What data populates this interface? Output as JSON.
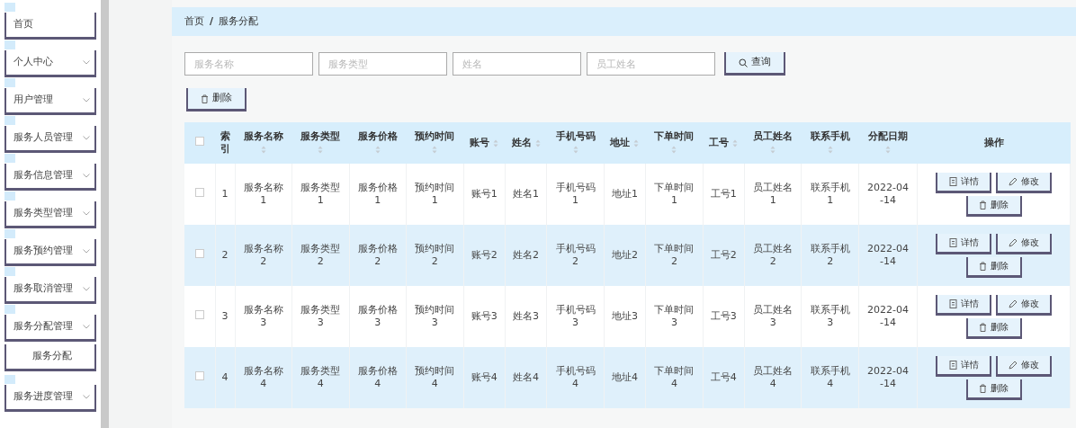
{
  "sidebar": {
    "items": [
      {
        "label": "首页",
        "kind": "link"
      },
      {
        "label": "个人中心",
        "kind": "menu"
      },
      {
        "label": "用户管理",
        "kind": "menu"
      },
      {
        "label": "服务人员管理",
        "kind": "menu"
      },
      {
        "label": "服务信息管理",
        "kind": "menu"
      },
      {
        "label": "服务类型管理",
        "kind": "menu"
      },
      {
        "label": "服务预约管理",
        "kind": "menu"
      },
      {
        "label": "服务取消管理",
        "kind": "menu"
      },
      {
        "label": "服务分配管理",
        "kind": "menu"
      },
      {
        "label": "服务分配",
        "kind": "sub"
      },
      {
        "label": "服务进度管理",
        "kind": "menu"
      }
    ]
  },
  "breadcrumb": {
    "items": [
      "首页",
      "服务分配"
    ],
    "separator": "/"
  },
  "search": {
    "fields": [
      {
        "placeholder": "服务名称"
      },
      {
        "placeholder": "服务类型"
      },
      {
        "placeholder": "姓名"
      },
      {
        "placeholder": "员工姓名"
      }
    ],
    "button": "查询"
  },
  "toolbar": {
    "delete_button": "删除"
  },
  "table": {
    "all_selected": false,
    "columns": [
      {
        "label": "索引",
        "sortable": false
      },
      {
        "label": "服务名称",
        "sortable": true
      },
      {
        "label": "服务类型",
        "sortable": true
      },
      {
        "label": "服务价格",
        "sortable": true
      },
      {
        "label": "预约时间",
        "sortable": true
      },
      {
        "label": "账号",
        "sortable": true
      },
      {
        "label": "姓名",
        "sortable": true
      },
      {
        "label": "手机号码",
        "sortable": true
      },
      {
        "label": "地址",
        "sortable": true
      },
      {
        "label": "下单时间",
        "sortable": true
      },
      {
        "label": "工号",
        "sortable": true
      },
      {
        "label": "员工姓名",
        "sortable": true
      },
      {
        "label": "联系手机",
        "sortable": true
      },
      {
        "label": "分配日期",
        "sortable": true
      },
      {
        "label": "操作",
        "sortable": false
      }
    ],
    "rows": [
      {
        "selected": false,
        "cells": [
          "1",
          "服务名称1",
          "服务类型1",
          "服务价格1",
          "预约时间1",
          "账号1",
          "姓名1",
          "手机号码1",
          "地址1",
          "下单时间1",
          "工号1",
          "员工姓名1",
          "联系手机1",
          "2022-04-14"
        ],
        "actions": [
          {
            "kind": "detail",
            "label": "详情"
          },
          {
            "kind": "edit",
            "label": "修改"
          },
          {
            "kind": "delete",
            "label": "删除"
          }
        ]
      },
      {
        "selected": false,
        "cells": [
          "2",
          "服务名称2",
          "服务类型2",
          "服务价格2",
          "预约时间2",
          "账号2",
          "姓名2",
          "手机号码2",
          "地址2",
          "下单时间2",
          "工号2",
          "员工姓名2",
          "联系手机2",
          "2022-04-14"
        ],
        "actions": [
          {
            "kind": "detail",
            "label": "详情"
          },
          {
            "kind": "edit",
            "label": "修改"
          },
          {
            "kind": "delete",
            "label": "删除"
          }
        ]
      },
      {
        "selected": false,
        "cells": [
          "3",
          "服务名称3",
          "服务类型3",
          "服务价格3",
          "预约时间3",
          "账号3",
          "姓名3",
          "手机号码3",
          "地址3",
          "下单时间3",
          "工号3",
          "员工姓名3",
          "联系手机3",
          "2022-04-14"
        ],
        "actions": [
          {
            "kind": "detail",
            "label": "详情"
          },
          {
            "kind": "edit",
            "label": "修改"
          },
          {
            "kind": "delete",
            "label": "删除"
          }
        ]
      },
      {
        "selected": false,
        "cells": [
          "4",
          "服务名称4",
          "服务类型4",
          "服务价格4",
          "预约时间4",
          "账号4",
          "姓名4",
          "手机号码4",
          "地址4",
          "下单时间4",
          "工号4",
          "员工姓名4",
          "联系手机4",
          "2022-04-14"
        ],
        "actions": [
          {
            "kind": "detail",
            "label": "详情"
          },
          {
            "kind": "edit",
            "label": "修改"
          },
          {
            "kind": "delete",
            "label": "删除"
          }
        ]
      }
    ]
  }
}
